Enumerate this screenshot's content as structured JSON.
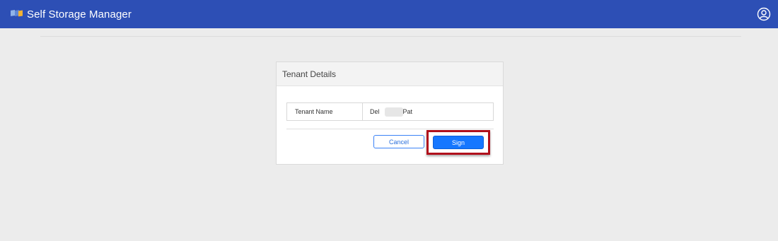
{
  "header": {
    "app_title": "Self Storage Manager",
    "logo_icon": "colored-flags-logo",
    "user_icon": "user-circle-icon",
    "bar_color": "#2d4fb5"
  },
  "card": {
    "title": "Tenant Details",
    "rows": [
      {
        "label": "Tenant Name",
        "value_prefix": "Del ",
        "value_suffix": ", Pat"
      }
    ]
  },
  "actions": {
    "cancel_label": "Cancel",
    "sign_label": "Sign",
    "highlight_color": "#b0101c"
  }
}
